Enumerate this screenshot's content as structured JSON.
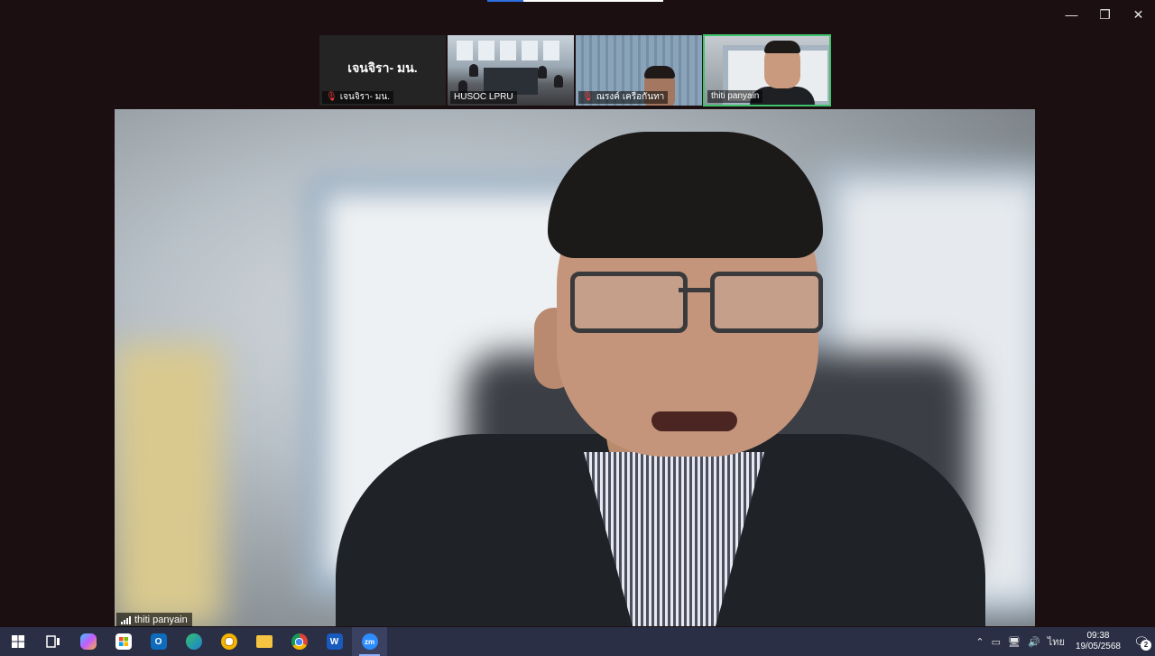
{
  "window": {
    "minimize_icon": "minimize-icon",
    "restore_icon": "restore-icon",
    "close_icon": "close-icon"
  },
  "gallery": {
    "tiles": [
      {
        "big_name": "เจนจิรา- มน.",
        "label": "เจนจิรา- มน.",
        "muted": true
      },
      {
        "label": "HUSOC LPRU",
        "muted": false
      },
      {
        "label": "ณรงค์ เครือกันทา",
        "muted": true
      },
      {
        "label": "thiti panyain",
        "muted": false,
        "active_speaker": true
      }
    ]
  },
  "main_video": {
    "label": "thiti panyain"
  },
  "taskbar": {
    "apps": [
      {
        "name": "start",
        "icon": "windows-icon"
      },
      {
        "name": "task-view",
        "icon": "task-view-icon"
      },
      {
        "name": "copilot",
        "icon": "copilot-icon"
      },
      {
        "name": "microsoft-store",
        "icon": "store-icon"
      },
      {
        "name": "outlook",
        "icon": "outlook-icon"
      },
      {
        "name": "edge",
        "icon": "edge-icon"
      },
      {
        "name": "chrome-canary",
        "icon": "chrome-yellow-icon"
      },
      {
        "name": "file-explorer",
        "icon": "folder-icon"
      },
      {
        "name": "chrome",
        "icon": "chrome-icon"
      },
      {
        "name": "word",
        "icon": "word-icon"
      },
      {
        "name": "zoom",
        "icon": "zoom-icon",
        "text": "zm",
        "active": true
      }
    ],
    "tray": {
      "language": "ไทย",
      "time": "09:38",
      "date": "19/05/2568",
      "notification_count": "2"
    }
  },
  "colors": {
    "background": "#1c0f12",
    "active_speaker_border": "#3ec46d",
    "taskbar": "#2a2f45",
    "muted_mic": "#ff3b3b"
  }
}
